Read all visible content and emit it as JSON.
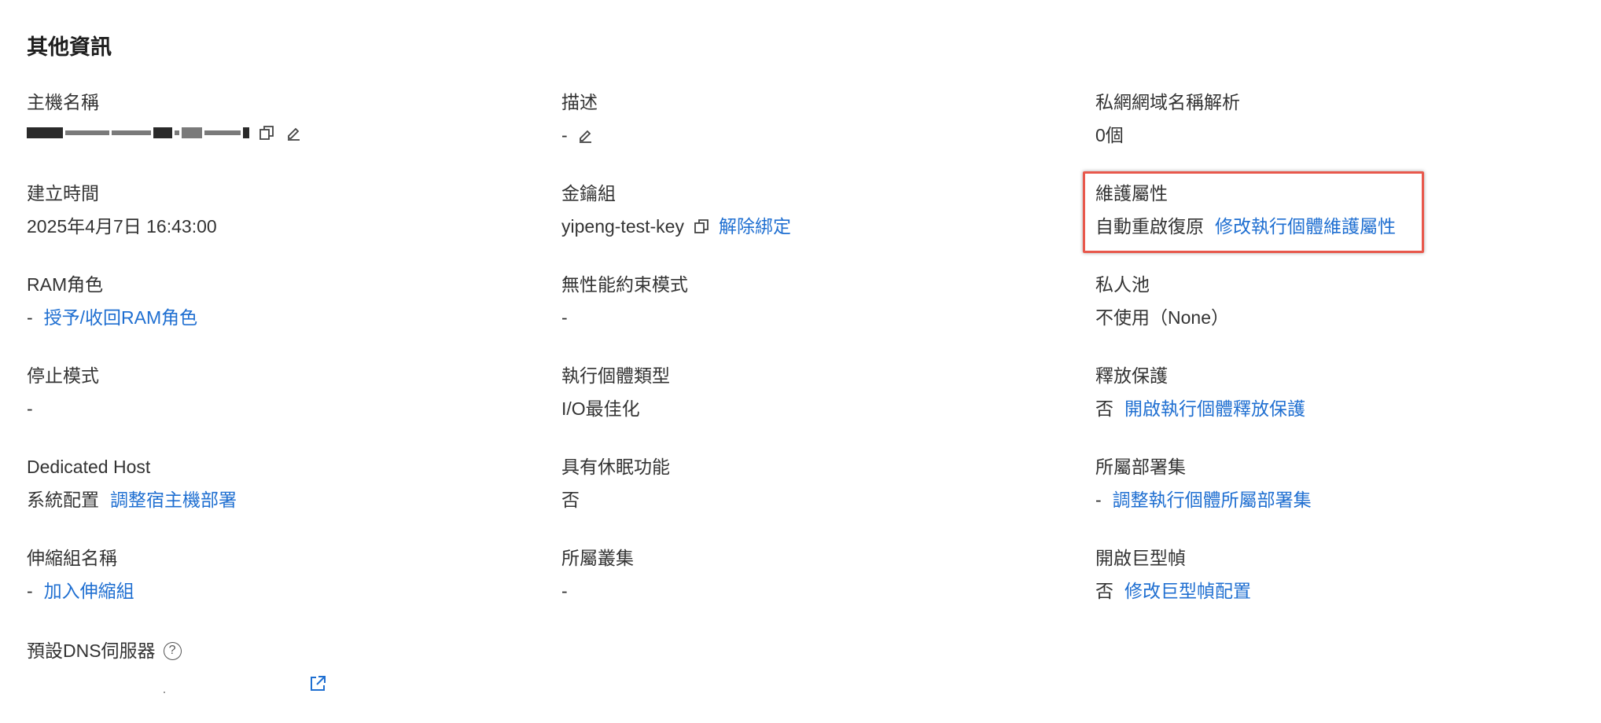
{
  "section_title": "其他資訊",
  "fields": {
    "hostname": {
      "label": "主機名稱"
    },
    "description": {
      "label": "描述",
      "value": "-"
    },
    "private_dns": {
      "label": "私網網域名稱解析",
      "value": "0個"
    },
    "created_time": {
      "label": "建立時間",
      "value": "2025年4月7日 16:43:00"
    },
    "key_pair": {
      "label": "金鑰組",
      "value": "yipeng-test-key",
      "action": "解除綁定"
    },
    "maintenance": {
      "label": "維護屬性",
      "value": "自動重啟復原",
      "action": "修改執行個體維護屬性"
    },
    "ram_role": {
      "label": "RAM角色",
      "value": "-",
      "action": "授予/收回RAM角色"
    },
    "perf_constraint": {
      "label": "無性能約束模式",
      "value": "-"
    },
    "private_pool": {
      "label": "私人池",
      "value": "不使用（None）"
    },
    "stop_mode": {
      "label": "停止模式",
      "value": "-"
    },
    "instance_type": {
      "label": "執行個體類型",
      "value": "I/O最佳化"
    },
    "release_protection": {
      "label": "釋放保護",
      "value": "否",
      "action": "開啟執行個體釋放保護"
    },
    "dedicated_host": {
      "label": "Dedicated Host",
      "value": "系統配置",
      "action": "調整宿主機部署"
    },
    "hibernation": {
      "label": "具有休眠功能",
      "value": "否"
    },
    "deployment_set": {
      "label": "所屬部署集",
      "value": "-",
      "action": "調整執行個體所屬部署集"
    },
    "scaling_group": {
      "label": "伸縮組名稱",
      "value": "-",
      "action": "加入伸縮組"
    },
    "cluster": {
      "label": "所屬叢集",
      "value": "-"
    },
    "jumbo_frame": {
      "label": "開啟巨型幀",
      "value": "否",
      "action": "修改巨型幀配置"
    },
    "dns_server": {
      "label": "預設DNS伺服器",
      "help": "?"
    }
  },
  "colors": {
    "link": "#1f6fd1",
    "text": "#333333",
    "highlight_border": "#e8584c"
  },
  "icons": [
    "copy-icon",
    "edit-icon",
    "help-icon",
    "external-link-icon"
  ]
}
